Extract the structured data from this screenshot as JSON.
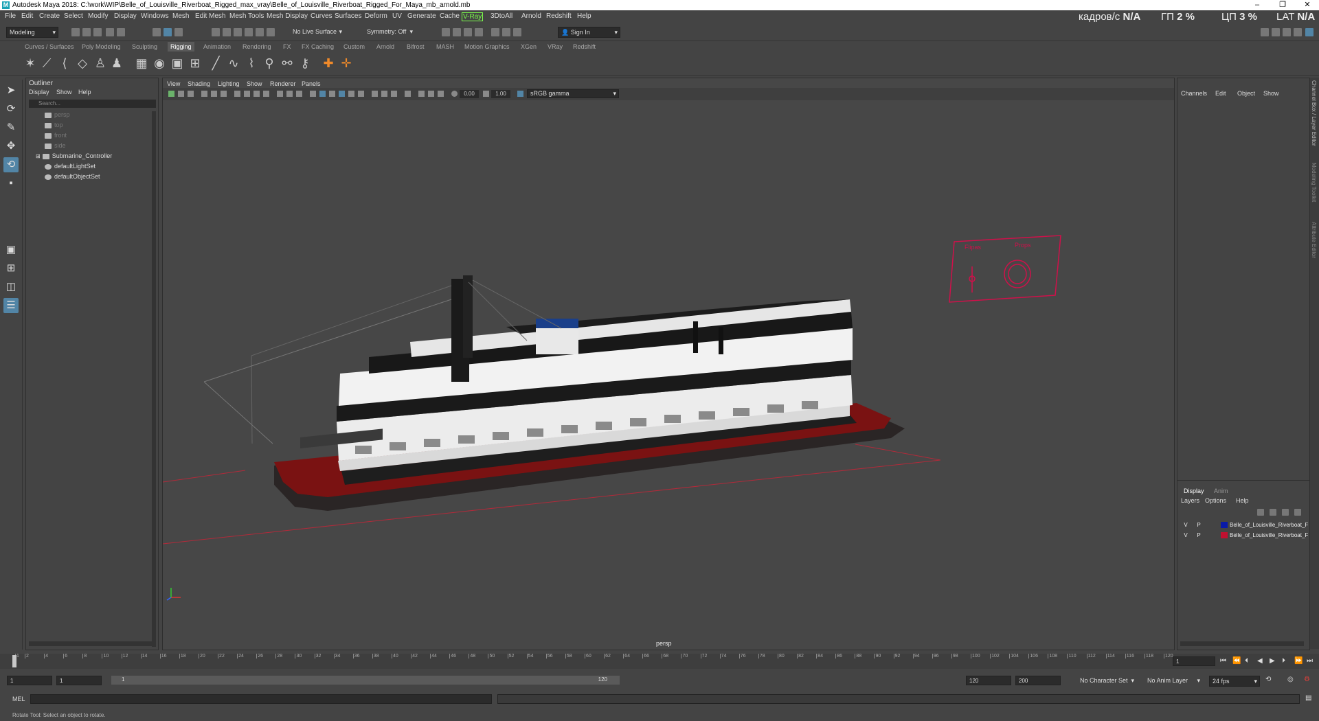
{
  "window": {
    "title": "Autodesk Maya 2018: C:\\work\\WIP\\Belle_of_Louisville_Riverboat_Rigged_max_vray\\Belle_of_Louisville_Riverboat_Rigged_For_Maya_mb_arnold.mb",
    "minimize": "–",
    "maximize": "❐",
    "close": "✕"
  },
  "menubar": {
    "items": [
      "File",
      "Edit",
      "Create",
      "Select",
      "Modify",
      "Display",
      "Windows",
      "Mesh",
      "Edit Mesh",
      "Mesh Tools",
      "Mesh Display",
      "Curves",
      "Surfaces",
      "Deform",
      "UV",
      "Generate",
      "Cache",
      "V-Ray",
      "3DtoAll",
      "Arnold",
      "Redshift",
      "Help"
    ]
  },
  "stats": {
    "fps_label": "кадров/с",
    "fps_value": "N/A",
    "gpu_label": "ГП",
    "gpu_value": "2 %",
    "cpu_label": "ЦП",
    "cpu_value": "3 %",
    "lat_label": "LAT",
    "lat_value": "N/A"
  },
  "statusline": {
    "mode": "Modeling",
    "live_surface": "No Live Surface",
    "symmetry": "Symmetry: Off",
    "sign_in": "Sign In"
  },
  "shelf_tabs": [
    "Curves / Surfaces",
    "Poly Modeling",
    "Sculpting",
    "Rigging",
    "Animation",
    "Rendering",
    "FX",
    "FX Caching",
    "Custom",
    "Arnold",
    "Bifrost",
    "MASH",
    "Motion Graphics",
    "XGen",
    "VRay",
    "Redshift"
  ],
  "active_shelf_tab": "Rigging",
  "outliner": {
    "title": "Outliner",
    "menu": [
      "Display",
      "Show",
      "Help"
    ],
    "search_placeholder": "Search...",
    "items": [
      {
        "label": "persp",
        "dim": true
      },
      {
        "label": "top",
        "dim": true
      },
      {
        "label": "front",
        "dim": true
      },
      {
        "label": "side",
        "dim": true
      },
      {
        "label": "Submarine_Controller",
        "dim": false
      },
      {
        "label": "defaultLightSet",
        "dim": false
      },
      {
        "label": "defaultObjectSet",
        "dim": false
      }
    ]
  },
  "viewport": {
    "menu": [
      "View",
      "Shading",
      "Lighting",
      "Show",
      "Renderer",
      "Panels"
    ],
    "exposure": "0.00",
    "gamma": "1.00",
    "color_space": "sRGB gamma",
    "camera": "persp",
    "control_labels": [
      "Flipas",
      "Props"
    ]
  },
  "channelbox": {
    "menu": [
      "Channels",
      "Edit",
      "Object",
      "Show"
    ],
    "tabs": [
      "Display",
      "Anim"
    ],
    "layer_menu": [
      "Layers",
      "Options",
      "Help"
    ],
    "layers": [
      {
        "v": "V",
        "p": "P",
        "color": "#0a1aa8",
        "name": "Belle_of_Louisville_Riverboat_F"
      },
      {
        "v": "V",
        "p": "P",
        "color": "#c01030",
        "name": "Belle_of_Louisville_Riverboat_F"
      }
    ]
  },
  "side_tabs": [
    "Channel Box / Layer Editor",
    "Modeling Toolkit",
    "Attribute Editor"
  ],
  "timeline": {
    "ticks": [
      "1",
      "2",
      "4",
      "6",
      "8",
      "10",
      "12",
      "14",
      "16",
      "18",
      "20",
      "22",
      "24",
      "26",
      "28",
      "30",
      "32",
      "34",
      "36",
      "38",
      "40",
      "42",
      "44",
      "46",
      "48",
      "50",
      "52",
      "54",
      "56",
      "58",
      "60",
      "62",
      "64",
      "66",
      "68",
      "70",
      "72",
      "74",
      "76",
      "78",
      "80",
      "82",
      "84",
      "86",
      "88",
      "90",
      "92",
      "94",
      "96",
      "98",
      "100",
      "102",
      "104",
      "106",
      "108",
      "110",
      "112",
      "114",
      "116",
      "118",
      "120"
    ],
    "current_frame": "1"
  },
  "range": {
    "start": "1",
    "playback_start": "1",
    "slider_start": "1",
    "slider_end": "120",
    "playback_end": "120",
    "end": "200",
    "character_set": "No Character Set",
    "anim_layer": "No Anim Layer",
    "fps": "24 fps"
  },
  "commandline": {
    "label": "MEL"
  },
  "helpline": {
    "text": "Rotate Tool: Select an object to rotate."
  }
}
